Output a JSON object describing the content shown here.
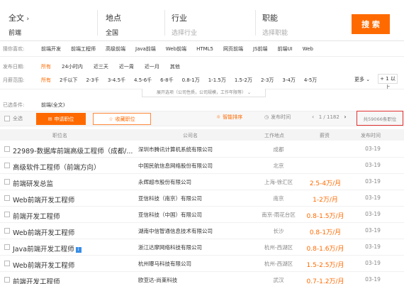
{
  "search": {
    "fulltext_label": "全文",
    "fulltext_value": "前端",
    "location_label": "地点",
    "location_value": "全国",
    "industry_label": "行业",
    "industry_placeholder": "选择行业",
    "position_label": "职能",
    "position_placeholder": "选择职能",
    "button": "搜 索"
  },
  "history": {
    "label": "猜你喜欢:",
    "items": [
      "前端开发",
      "前端工程师",
      "高级前端",
      "Java前端",
      "Web前端",
      "HTML5",
      "网页前端",
      "JS前端",
      "前端UI",
      "Web"
    ]
  },
  "date_filter": {
    "label": "发布日期:",
    "options": [
      "所有",
      "24小时内",
      "近三天",
      "近一周",
      "近一月",
      "其他"
    ]
  },
  "salary_filter": {
    "label": "月薪范围:",
    "options": [
      "所有",
      "2千以下",
      "2-3千",
      "3-4.5千",
      "4.5-6千",
      "6-8千",
      "0.8-1万",
      "1-1.5万",
      "1.5-2万",
      "2-3万",
      "3-4万",
      "4-5万"
    ],
    "more": "更多 ⌄",
    "above": "+ 1 以上"
  },
  "expand_text": "展开选项（公司性质，公司规模，工作年限等）",
  "selected": {
    "label": "已选条件:",
    "value": "前端(全文)"
  },
  "toolbar": {
    "select_all": "全选",
    "apply": "申请职位",
    "favorite": "收藏职位",
    "smart_sort": "智能排序",
    "time_sort": "发布时间",
    "page": "1 / 1182",
    "total": "共59066条职位"
  },
  "table": {
    "headers": [
      "职位名",
      "公司名",
      "工作地点",
      "薪资",
      "发布时间"
    ],
    "rows": [
      {
        "title": "22989-数据库前端高级工程师（成都/...",
        "company": "深圳市腾讯计算机系统有限公司",
        "location": "成都",
        "salary": "",
        "date": "03-19",
        "badge": ""
      },
      {
        "title": "高级软件工程师（前端方向）",
        "company": "中国民航信息网络股份有限公司",
        "location": "北京",
        "salary": "",
        "date": "03-19",
        "badge": ""
      },
      {
        "title": "前端研发总监",
        "company": "永辉超市股份有限公司",
        "location": "上海-徐汇区",
        "salary": "2.5-4万/月",
        "date": "03-19",
        "badge": ""
      },
      {
        "title": "Web前端开发工程师",
        "company": "亚信科技（南京）有限公司",
        "location": "南京",
        "salary": "1-2万/月",
        "date": "03-19",
        "badge": ""
      },
      {
        "title": "前端开发工程师",
        "company": "亚信科技（中国）有限公司",
        "location": "南京-雨花台区",
        "salary": "0.8-1.5万/月",
        "date": "03-19",
        "badge": ""
      },
      {
        "title": "Web前端开发工程师",
        "company": "湖南中信智通信息技术有限公司",
        "location": "长沙",
        "salary": "0.8-1万/月",
        "date": "03-19",
        "badge": ""
      },
      {
        "title": "Java前端开发工程师",
        "company": "浙江达摩网络科技有限公司",
        "location": "杭州-西湖区",
        "salary": "0.8-1.6万/月",
        "date": "03-19",
        "badge": "i"
      },
      {
        "title": "Web前端开发工程师",
        "company": "杭州曝马科技有限公司",
        "location": "杭州-西湖区",
        "salary": "1.5-2.5万/月",
        "date": "03-19",
        "badge": ""
      },
      {
        "title": "前端开发工程师",
        "company": "欧亚达-尚莱科技",
        "location": "武汉",
        "salary": "0.7-1.2万/月",
        "date": "03-19",
        "badge": ""
      }
    ]
  },
  "colors": {
    "accent": "#ff6a00",
    "highlight_box": "#e23030"
  }
}
